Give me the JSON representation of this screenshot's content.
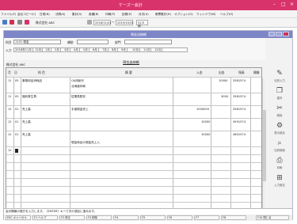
{
  "app": {
    "title": "ケーズー会計",
    "window_title": "現金出納帳"
  },
  "menu": [
    "ファイル(F)",
    "会社コピー(C)",
    "日常(N)",
    "決算(K)",
    "集計(S)",
    "各種(B)",
    "印刷(P)",
    "記帳(E)",
    "月次(U)",
    "帳票集計(H)",
    "オプション(O)",
    "ウィンドウ(W)",
    "ヘルプ(H)"
  ],
  "toolbar": {
    "company": "株式会社 ABC",
    "period_from": "2018/11/01",
    "period_sep": "〜",
    "period_to": "2019/10/31",
    "fiscal": "31/3期"
  },
  "filter": {
    "account_label": "科目",
    "account_value": "1101 現金",
    "sub_label": "補助",
    "dept_label": "部門",
    "input_label": "入力",
    "months": [
      "2018年11月",
      "12月",
      "1月",
      "2月",
      "3月",
      "4月",
      "5月",
      "6月",
      "7月",
      "8月",
      "9月",
      "10月",
      "11月",
      "12月"
    ],
    "book_title": "現金出納帳",
    "company_name": "株式会社 ABC"
  },
  "table": {
    "headers": {
      "month": "月",
      "day": "日",
      "account": "科 目",
      "summary": "摘 要",
      "in": "入金",
      "out": "出金",
      "balance": "残高",
      "info": "情報"
    },
    "rows": [
      {
        "m": "11",
        "d": "05",
        "acc": "事務用品消耗品",
        "summ1": "OA用紙代",
        "summ2": "北海道印刷",
        "in": "",
        "out": "10000",
        "bal": "3581574"
      },
      {
        "m": "11",
        "d": "05",
        "acc": "福利厚生費",
        "summ1": "従業員慰安",
        "summ2": "",
        "in": "",
        "out": "3000",
        "bal": "3581574"
      },
      {
        "m": "12",
        "d": "01",
        "acc": "売上高",
        "summ1": "手渡現金売上",
        "summ2": "",
        "in": "1000000",
        "out": "",
        "bal": "3581574"
      },
      {
        "m": "12",
        "d": "01",
        "acc": "売上高",
        "summ1": "",
        "summ2": "",
        "in": "10000",
        "out": "",
        "bal": "4591574"
      },
      {
        "m": "12",
        "d": "01",
        "acc": "売上高",
        "summ1": "",
        "summ2": "現金商品の現金売上入",
        "in": "10000",
        "out": "",
        "bal": "4601574"
      },
      {
        "m": "12",
        "d": "",
        "acc": "",
        "summ1": "",
        "summ2": "",
        "in": "",
        "out": "",
        "bal": ""
      }
    ]
  },
  "side": [
    {
      "icon": "pen-icon",
      "label": "仕訳入力"
    },
    {
      "icon": "copy-icon",
      "label": "複写"
    },
    {
      "icon": "delete-icon",
      "label": "削除"
    },
    {
      "icon": "settings-icon",
      "label": "表示設定"
    },
    {
      "icon": "search-icon",
      "label": "仕訳検索"
    },
    {
      "icon": "print-icon",
      "label": "印刷"
    },
    {
      "icon": "input-settings-icon",
      "label": "入力設定"
    }
  ],
  "status": "会計情報の借方を入力します。［ENTER］キーで次の項目に進みます。",
  "fkeys": [
    "ESC キャンセル",
    "F1 ヘルプ",
    "F2 修正",
    "F3 削除",
    "F4",
    "F5",
    "F6",
    "F7",
    "F8",
    "F10 閉じる"
  ]
}
